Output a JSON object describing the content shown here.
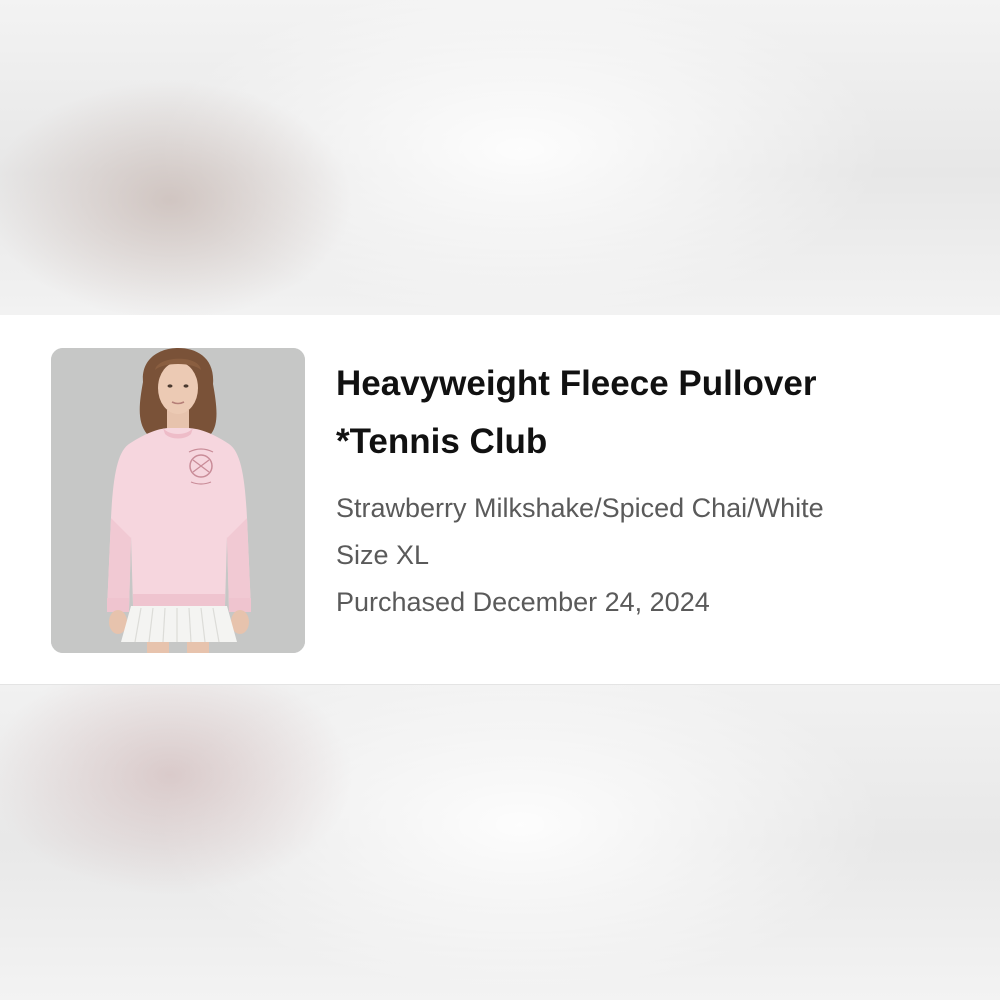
{
  "product": {
    "title_line1": "Heavyweight Fleece Pullover",
    "title_line2": "*Tennis Club",
    "color": "Strawberry Milkshake/Spiced Chai/White",
    "size": "Size XL",
    "purchased": "Purchased December 24, 2024",
    "image_icon": "product-photo"
  },
  "colors": {
    "card_background": "#ffffff",
    "title": "#111111",
    "detail_text": "#5a5a5a",
    "photo_backdrop": "#c6c7c6",
    "sweatshirt": "#f6d6de",
    "skirt": "#f4f4f2"
  }
}
